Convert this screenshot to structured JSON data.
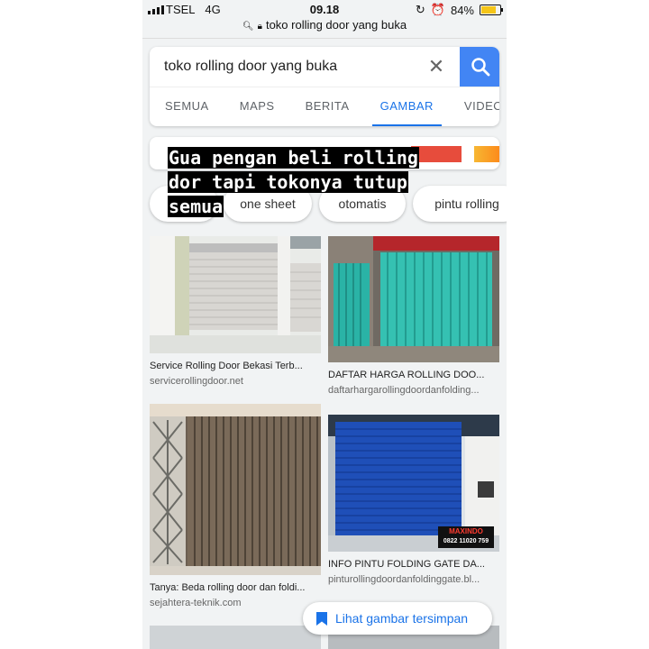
{
  "status": {
    "carrier": "TSEL",
    "network": "4G",
    "time": "09.18",
    "battery": "84%",
    "battery_level": 0.84
  },
  "url": {
    "text": "toko rolling door yang buka"
  },
  "search": {
    "query": "toko rolling door yang buka",
    "clear_icon": "close-icon",
    "search_icon": "search-icon"
  },
  "tabs": [
    {
      "label": "SEMUA"
    },
    {
      "label": "MAPS"
    },
    {
      "label": "BERITA"
    },
    {
      "label": "GAMBAR"
    },
    {
      "label": "VIDEO"
    }
  ],
  "chips": [
    {
      "label": "one sheet"
    },
    {
      "label": "otomatis"
    },
    {
      "label": "pintu rolling"
    }
  ],
  "overlay_lines": [
    "Gua pengan beli rolling",
    "dor tapi tokonya tutup",
    "semua"
  ],
  "results": [
    {
      "caption": "Service Rolling Door Bekasi Terb...",
      "source": "servicerollingdoor.net"
    },
    {
      "caption": "DAFTAR HARGA ROLLING DOO...",
      "source": "daftarhargarollingdoordanfolding..."
    },
    {
      "caption": "Tanya: Beda rolling door dan foldi...",
      "source": "sejahtera-teknik.com"
    },
    {
      "caption": "INFO PINTU FOLDING GATE DA...",
      "source": "pinturollingdoordanfoldinggate.bl..."
    }
  ],
  "watermark": {
    "brand": "MAXINDO",
    "phone": "0822 11020 759"
  },
  "saved_button": {
    "label": "Lihat gambar tersimpan"
  },
  "colors": {
    "accent": "#1a73e8",
    "search_button": "#4285f4"
  }
}
